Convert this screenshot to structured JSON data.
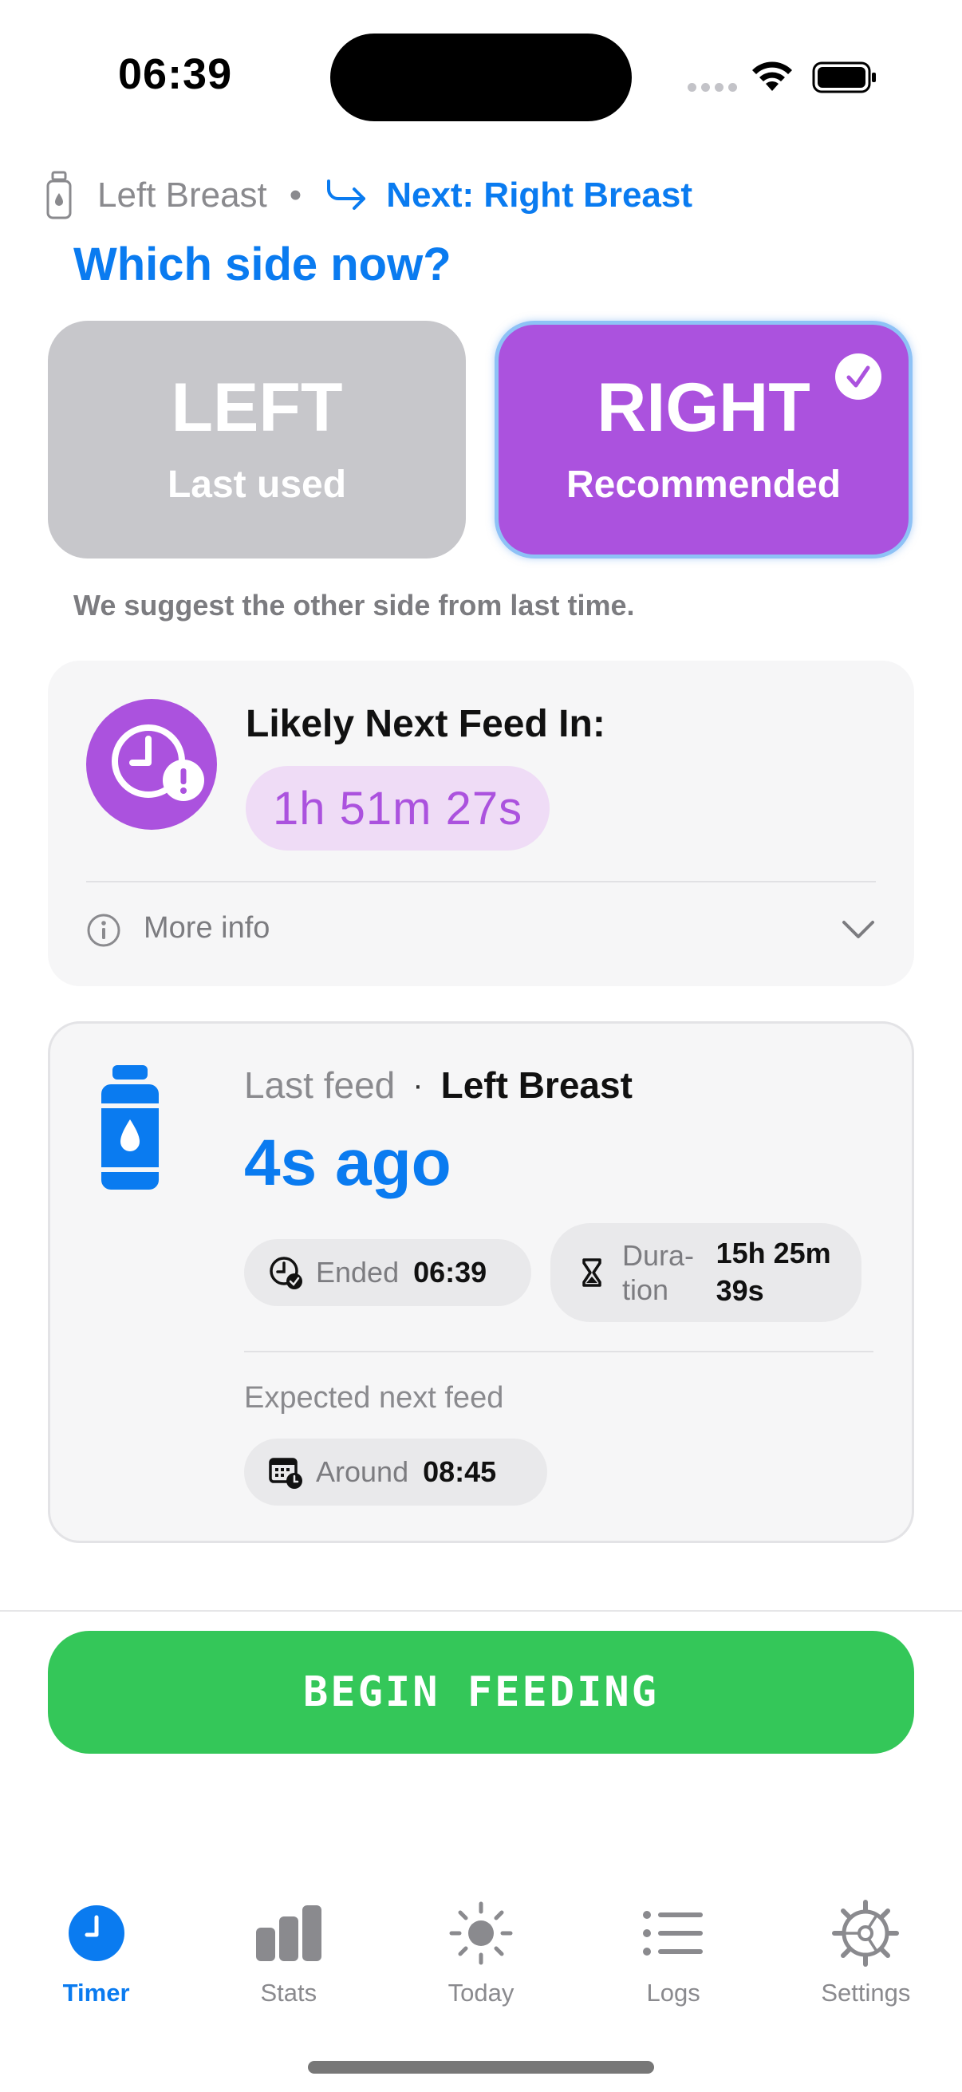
{
  "status_bar": {
    "time": "06:39"
  },
  "header": {
    "current_side": "Left Breast",
    "separator": "•",
    "next_side": "Next: Right Breast"
  },
  "question": "Which side now?",
  "side_buttons": {
    "left": {
      "label": "LEFT",
      "sub": "Last used",
      "color": "#c7c7cb"
    },
    "right": {
      "label": "RIGHT",
      "sub": "Recommended",
      "color": "#ab52de",
      "selected": true
    }
  },
  "suggestion": "We suggest the other side from last time.",
  "next_feed": {
    "title": "Likely Next Feed In:",
    "countdown": "1h 51m 27s",
    "more_info": "More info"
  },
  "last_feed": {
    "label": "Last feed",
    "separator": "·",
    "side": "Left Breast",
    "ago": "4s ago",
    "ended_label": "Ended",
    "ended_value": "06:39",
    "duration_label": "Dura-\ntion",
    "duration_value": "15h 25m 39s",
    "expected_label": "Expected next feed",
    "around_label": "Around",
    "around_value": "08:45"
  },
  "primary_action": {
    "label": "BEGIN FEEDING",
    "color": "#34c759"
  },
  "tab_bar": {
    "tabs": [
      {
        "label": "Timer",
        "icon": "timer-icon",
        "active": true
      },
      {
        "label": "Stats",
        "icon": "chart-bars-icon",
        "active": false
      },
      {
        "label": "Today",
        "icon": "sun-icon",
        "active": false
      },
      {
        "label": "Logs",
        "icon": "list-icon",
        "active": false
      },
      {
        "label": "Settings",
        "icon": "gear-icon",
        "active": false
      }
    ]
  },
  "colors": {
    "accent": "#0a7bf0",
    "purple": "#ab52de",
    "green": "#34c759"
  }
}
